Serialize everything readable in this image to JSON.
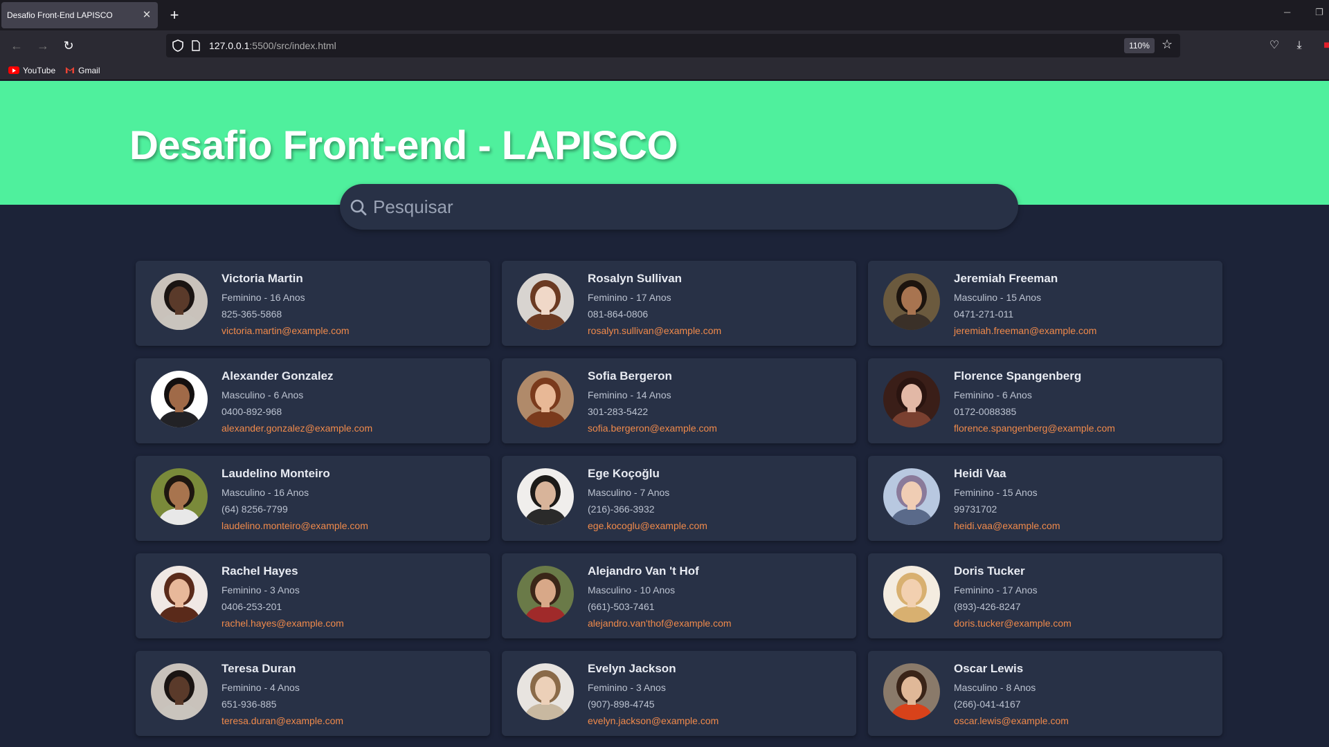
{
  "browser": {
    "tab_title": "Desafio Front-End LAPISCO",
    "url_host": "127.0.0.1",
    "url_path": ":5500/src/index.html",
    "zoom": "110%",
    "bookmarks": [
      "YouTube",
      "Gmail"
    ]
  },
  "page": {
    "title": "Desafio Front-end - LAPISCO",
    "search_placeholder": "Pesquisar",
    "accent": "#4ff09d",
    "email_color": "#f08a4b"
  },
  "people": [
    {
      "name": "Victoria Martin",
      "details": "Feminino - 16 Anos",
      "phone": "825-365-5868",
      "email": "victoria.martin@example.com",
      "skin": "#5a3a2a",
      "hair": "#1a1412",
      "bg": "#c9c2bb",
      "shirt": "#c9c4bd"
    },
    {
      "name": "Rosalyn Sullivan",
      "details": "Feminino - 17 Anos",
      "phone": "081-864-0806",
      "email": "rosalyn.sullivan@example.com",
      "skin": "#f0d8c8",
      "hair": "#6b3a22",
      "bg": "#d8d4d0",
      "shirt": "#6b3a22"
    },
    {
      "name": "Jeremiah Freeman",
      "details": "Masculino - 15 Anos",
      "phone": "0471-271-011",
      "email": "jeremiah.freeman@example.com",
      "skin": "#a87450",
      "hair": "#1c140e",
      "bg": "#6b5a3e",
      "shirt": "#3a3028"
    },
    {
      "name": "Alexander Gonzalez",
      "details": "Masculino - 6 Anos",
      "phone": "0400-892-968",
      "email": "alexander.gonzalez@example.com",
      "skin": "#a06a48",
      "hair": "#141010",
      "bg": "#ffffff",
      "shirt": "#222226"
    },
    {
      "name": "Sofia Bergeron",
      "details": "Feminino - 14 Anos",
      "phone": "301-283-5422",
      "email": "sofia.bergeron@example.com",
      "skin": "#e8b896",
      "hair": "#7a3a1c",
      "bg": "#b08a6a",
      "shirt": "#7a3a1c"
    },
    {
      "name": "Florence Spangenberg",
      "details": "Feminino - 6 Anos",
      "phone": "0172-0088385",
      "email": "florence.spangenberg@example.com",
      "skin": "#e2b8a6",
      "hair": "#2a1410",
      "bg": "#3a1e18",
      "shirt": "#7a4030"
    },
    {
      "name": "Laudelino Monteiro",
      "details": "Masculino - 16 Anos",
      "phone": "(64) 8256-7799",
      "email": "laudelino.monteiro@example.com",
      "skin": "#a8744e",
      "hair": "#1e1610",
      "bg": "#7a8a3a",
      "shirt": "#e8e8e8"
    },
    {
      "name": "Ege Koçoğlu",
      "details": "Masculino - 7 Anos",
      "phone": "(216)-366-3932",
      "email": "ege.kocoglu@example.com",
      "skin": "#d8b49a",
      "hair": "#1c1a18",
      "bg": "#f0eeec",
      "shirt": "#2a2a2a"
    },
    {
      "name": "Heidi Vaa",
      "details": "Feminino - 15 Anos",
      "phone": "99731702",
      "email": "heidi.vaa@example.com",
      "skin": "#f0cdb4",
      "hair": "#8a7a9a",
      "bg": "#b8c8e0",
      "shirt": "#5a6a8a"
    },
    {
      "name": "Rachel Hayes",
      "details": "Feminino - 3 Anos",
      "phone": "0406-253-201",
      "email": "rachel.hayes@example.com",
      "skin": "#e8b89a",
      "hair": "#5a2a1a",
      "bg": "#f0e8e4",
      "shirt": "#5a2a1a"
    },
    {
      "name": "Alejandro Van 't Hof",
      "details": "Masculino - 10 Anos",
      "phone": "(661)-503-7461",
      "email": "alejandro.van'thof@example.com",
      "skin": "#d8a888",
      "hair": "#3a2618",
      "bg": "#6a7a48",
      "shirt": "#a02a2a"
    },
    {
      "name": "Doris Tucker",
      "details": "Feminino - 17 Anos",
      "phone": "(893)-426-8247",
      "email": "doris.tucker@example.com",
      "skin": "#f2d0b0",
      "hair": "#d8b070",
      "bg": "#f4ece0",
      "shirt": "#d8b070"
    },
    {
      "name": "Teresa Duran",
      "details": "Feminino - 4 Anos",
      "phone": "651-936-885",
      "email": "teresa.duran@example.com",
      "skin": "#5a3a2a",
      "hair": "#1a1412",
      "bg": "#c9c2bb",
      "shirt": "#c9c4bd"
    },
    {
      "name": "Evelyn Jackson",
      "details": "Feminino - 3 Anos",
      "phone": "(907)-898-4745",
      "email": "evelyn.jackson@example.com",
      "skin": "#ecd0b8",
      "hair": "#8a6a48",
      "bg": "#e8e4e0",
      "shirt": "#c8b8a0"
    },
    {
      "name": "Oscar Lewis",
      "details": "Masculino - 8 Anos",
      "phone": "(266)-041-4167",
      "email": "oscar.lewis@example.com",
      "skin": "#e0b898",
      "hair": "#3a2418",
      "bg": "#8a7a6a",
      "shirt": "#d8421a"
    }
  ]
}
